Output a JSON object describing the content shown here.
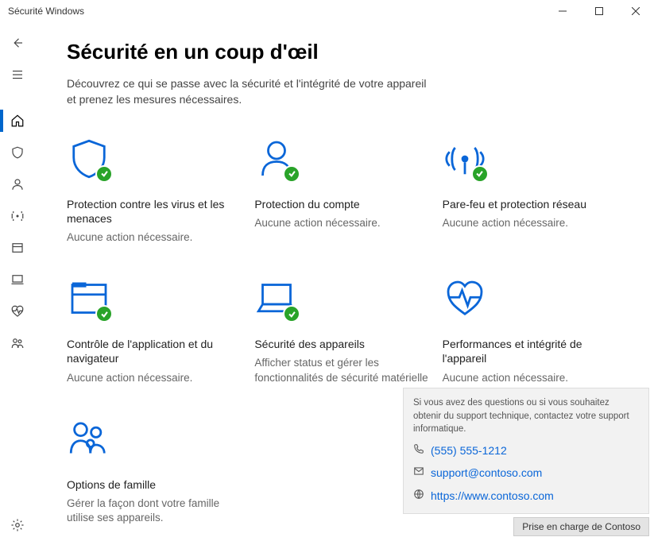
{
  "window_title": "Sécurité Windows",
  "page": {
    "heading": "Sécurité en un coup d'œil",
    "subtitle": "Découvrez ce qui se passe avec la sécurité et l'intégrité de votre appareil et prenez les mesures nécessaires."
  },
  "tiles": {
    "virus": {
      "title": "Protection contre les virus et les menaces",
      "desc": "Aucune action nécessaire."
    },
    "account": {
      "title": "Protection du compte",
      "desc": "Aucune action nécessaire."
    },
    "firewall": {
      "title": "Pare-feu et protection réseau",
      "desc": "Aucune action nécessaire."
    },
    "appctrl": {
      "title": "Contrôle de l'application et du navigateur",
      "desc": "Aucune action nécessaire."
    },
    "device": {
      "title": "Sécurité des appareils",
      "desc": "Afficher status et gérer les fonctionnalités de sécurité matérielle"
    },
    "perf": {
      "title": "Performances et intégrité de l'appareil",
      "desc": "Aucune action nécessaire."
    },
    "family": {
      "title": "Options de famille",
      "desc": "Gérer la façon dont votre famille utilise ses appareils."
    }
  },
  "support": {
    "text": "Si vous avez des questions ou si vous souhaitez obtenir du support technique, contactez votre support informatique.",
    "phone": "(555) 555-1212",
    "email": "support@contoso.com",
    "url": "https://www.contoso.com",
    "footer": "Prise en charge de Contoso"
  }
}
